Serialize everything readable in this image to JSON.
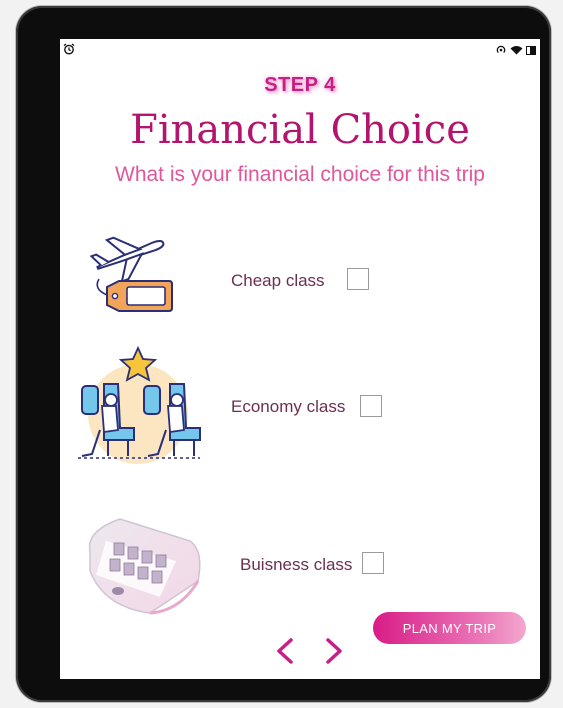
{
  "status_bar": {
    "left_icon": "alarm-icon",
    "right_icons": [
      "hotspot-icon",
      "wifi-icon",
      "battery-icon"
    ]
  },
  "header": {
    "step": "STEP 4",
    "title": "Financial Choice",
    "subtitle": "What is your financial choice for this trip"
  },
  "options": [
    {
      "label": "Cheap class",
      "icon": "plane-ticket-icon",
      "checked": false
    },
    {
      "label": "Economy class",
      "icon": "airplane-seats-icon",
      "checked": false
    },
    {
      "label": "Buisness class",
      "icon": "business-cabin-icon",
      "checked": false
    }
  ],
  "actions": {
    "plan_label": "PLAN MY TRIP"
  },
  "nav": {
    "prev_icon": "chevron-left-icon",
    "next_icon": "chevron-right-icon"
  },
  "colors": {
    "accent": "#c61f86",
    "title": "#b3156e",
    "subtitle": "#e0579c",
    "label": "#6c2f4f"
  }
}
